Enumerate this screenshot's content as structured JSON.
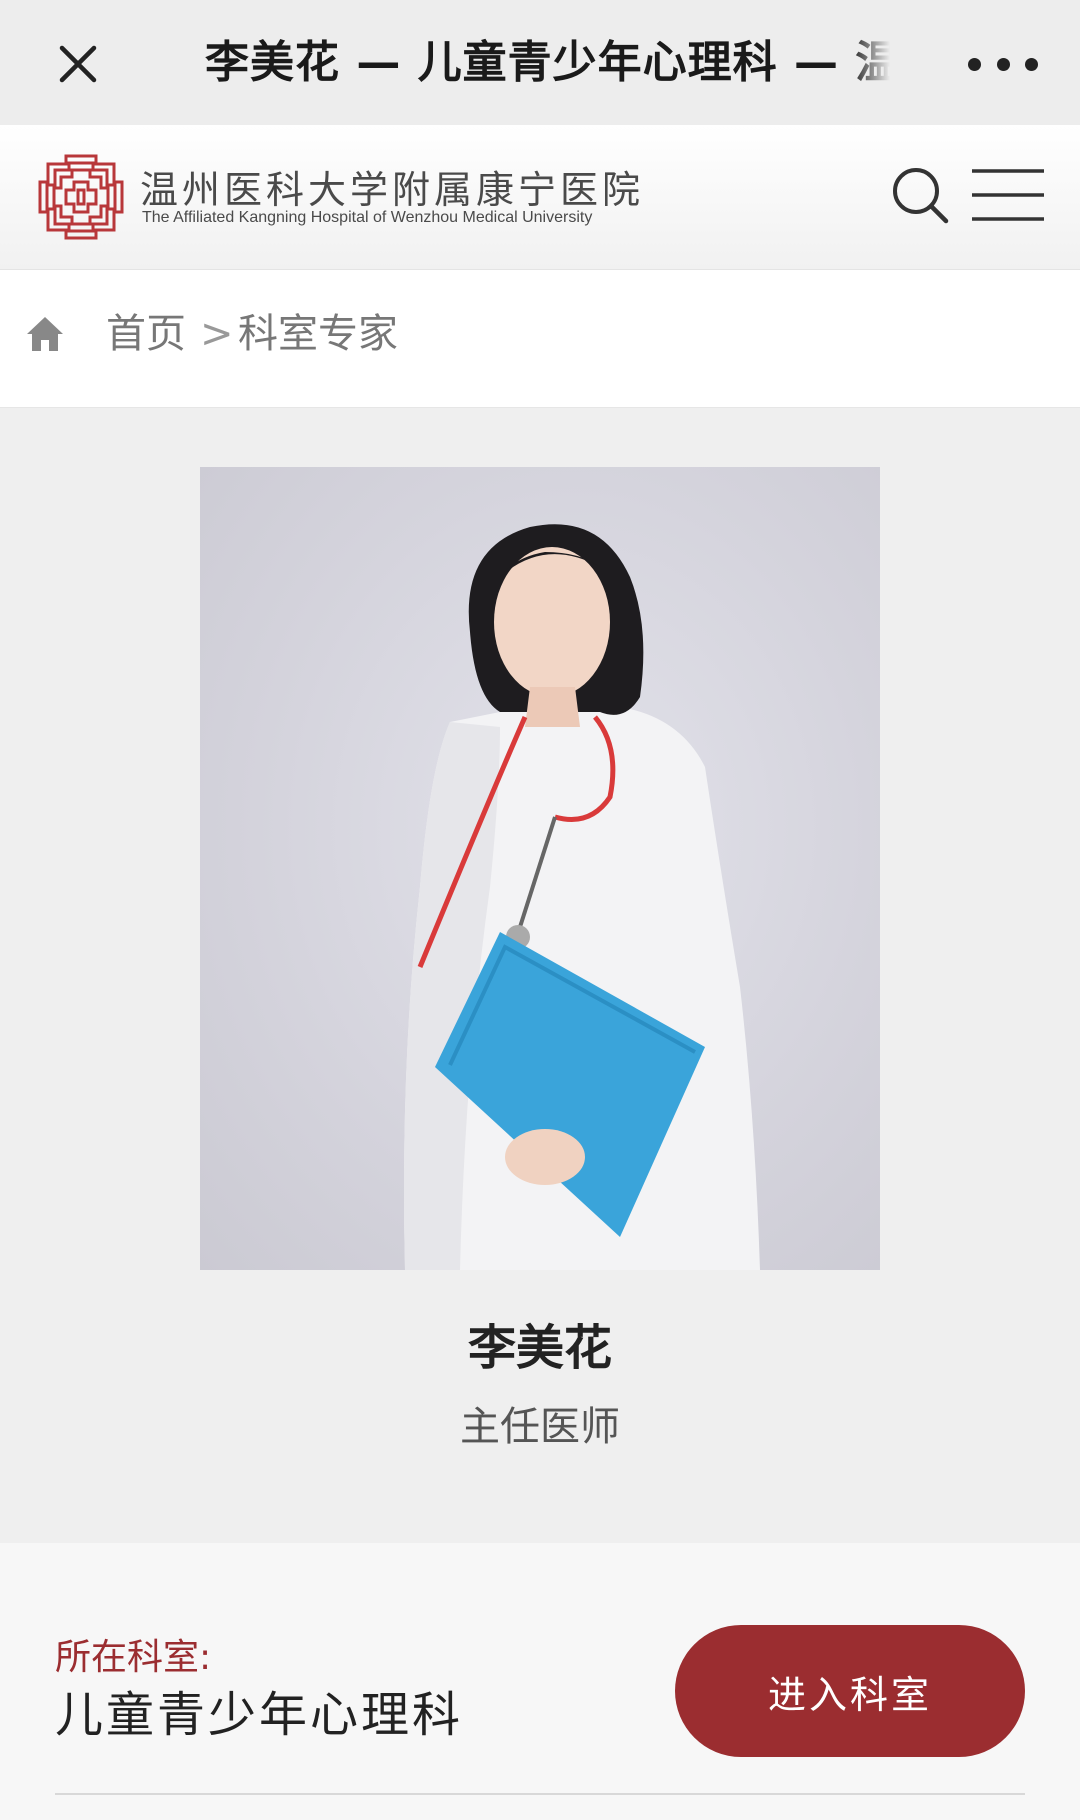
{
  "window": {
    "title": "李美花 — 儿童青少年心理科 — 温",
    "close_icon": "close-icon",
    "more_icon": "more-dots-icon"
  },
  "header": {
    "logo_icon": "hospital-logo-icon",
    "name_cn": "温州医科大学附属康宁医院",
    "name_en": "The Affiliated Kangning Hospital of Wenzhou Medical University",
    "search_icon": "search-icon",
    "menu_icon": "hamburger-menu-icon"
  },
  "breadcrumb": {
    "home_icon": "home-icon",
    "home_label": "首页",
    "separator": ">",
    "current": "科室专家"
  },
  "profile": {
    "name": "李美花",
    "title": "主任医师"
  },
  "department": {
    "label": "所在科室:",
    "name": "儿童青少年心理科",
    "enter_button": "进入科室"
  },
  "colors": {
    "brand": "#9b2d30",
    "topbar_bg": "#ededed",
    "page_bg": "#efefef"
  }
}
